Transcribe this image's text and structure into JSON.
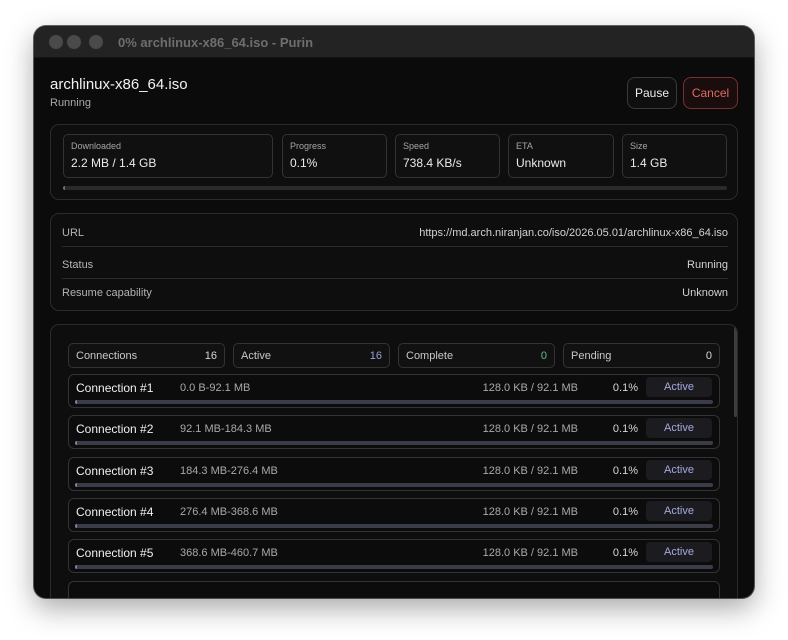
{
  "window": {
    "title": "0% archlinux-x86_64.iso - Purin"
  },
  "header": {
    "file_name": "archlinux-x86_64.iso",
    "status": "Running"
  },
  "actions": {
    "pause_label": "Pause",
    "cancel_label": "Cancel"
  },
  "stats": [
    {
      "label": "Downloaded",
      "value": "2.2 MB / 1.4 GB"
    },
    {
      "label": "Progress",
      "value": "0.1%"
    },
    {
      "label": "Speed",
      "value": "738.4 KB/s"
    },
    {
      "label": "ETA",
      "value": "Unknown"
    },
    {
      "label": "Size",
      "value": "1.4 GB"
    }
  ],
  "overall_progress_fraction": 0.001,
  "info": [
    {
      "label": "URL",
      "value": "https://md.arch.niranjan.co/iso/2026.05.01/archlinux-x86_64.iso"
    },
    {
      "label": "Status",
      "value": "Running"
    },
    {
      "label": "Resume capability",
      "value": "Unknown"
    }
  ],
  "connection_summary": [
    {
      "label": "Connections",
      "value": "16"
    },
    {
      "label": "Active",
      "value": "16"
    },
    {
      "label": "Complete",
      "value": "0"
    },
    {
      "label": "Pending",
      "value": "0"
    }
  ],
  "connections": [
    {
      "name": "Connection #1",
      "range": "0.0 B-92.1 MB",
      "bytes": "128.0 KB / 92.1 MB",
      "percent": "0.1%",
      "state": "Active",
      "progress_fraction": 0.001
    },
    {
      "name": "Connection #2",
      "range": "92.1 MB-184.3 MB",
      "bytes": "128.0 KB / 92.1 MB",
      "percent": "0.1%",
      "state": "Active",
      "progress_fraction": 0.001
    },
    {
      "name": "Connection #3",
      "range": "184.3 MB-276.4 MB",
      "bytes": "128.0 KB / 92.1 MB",
      "percent": "0.1%",
      "state": "Active",
      "progress_fraction": 0.001
    },
    {
      "name": "Connection #4",
      "range": "276.4 MB-368.6 MB",
      "bytes": "128.0 KB / 92.1 MB",
      "percent": "0.1%",
      "state": "Active",
      "progress_fraction": 0.001
    },
    {
      "name": "Connection #5",
      "range": "368.6 MB-460.7 MB",
      "bytes": "128.0 KB / 92.1 MB",
      "percent": "0.1%",
      "state": "Active",
      "progress_fraction": 0.001
    }
  ],
  "colors": {
    "window_bg": "#0b0b0b",
    "cancel_accent": "#e06a62",
    "active_accent": "#9aa3d6",
    "complete_accent": "#5fbf7f"
  }
}
